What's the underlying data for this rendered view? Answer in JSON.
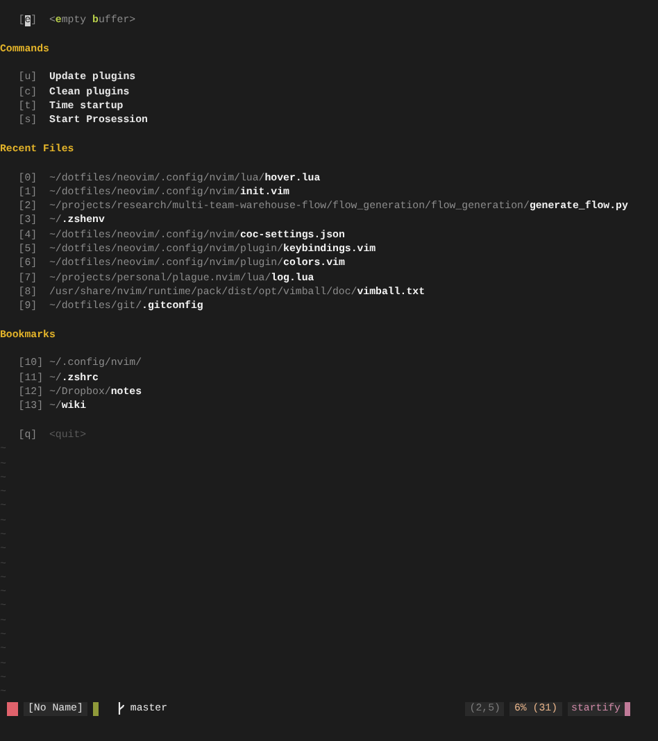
{
  "header": {
    "key_parts": [
      {
        "text": "[",
        "cursor": false
      },
      {
        "text": "e",
        "cursor": true
      },
      {
        "text": "]",
        "cursor": false
      }
    ],
    "label_parts": [
      {
        "text": "<",
        "hint": false
      },
      {
        "text": "e",
        "hint": true
      },
      {
        "text": "mpty ",
        "hint": false
      },
      {
        "text": "b",
        "hint": true
      },
      {
        "text": "uffer>",
        "hint": false
      }
    ]
  },
  "sections": [
    {
      "title": "Commands",
      "items": [
        {
          "kind": "command",
          "key": "[u]",
          "label": "Update plugins"
        },
        {
          "kind": "command",
          "key": "[c]",
          "label": "Clean plugins"
        },
        {
          "kind": "command",
          "key": "[t]",
          "label": "Time startup"
        },
        {
          "kind": "command",
          "key": "[s]",
          "label": "Start Prosession"
        }
      ]
    },
    {
      "title": "Recent Files",
      "items": [
        {
          "kind": "path",
          "key": "[0]",
          "dir": "~/dotfiles/neovim/.config/nvim/lua/",
          "file": "hover.lua"
        },
        {
          "kind": "path",
          "key": "[1]",
          "dir": "~/dotfiles/neovim/.config/nvim/",
          "file": "init.vim"
        },
        {
          "kind": "path",
          "key": "[2]",
          "dir": "~/projects/research/multi-team-warehouse-flow/flow_generation/flow_generation/",
          "file": "generate_flow.py"
        },
        {
          "kind": "path",
          "key": "[3]",
          "dir": "~/",
          "file": ".zshenv"
        },
        {
          "kind": "path",
          "key": "[4]",
          "dir": "~/dotfiles/neovim/.config/nvim/",
          "file": "coc-settings.json"
        },
        {
          "kind": "path",
          "key": "[5]",
          "dir": "~/dotfiles/neovim/.config/nvim/plugin/",
          "file": "keybindings.vim"
        },
        {
          "kind": "path",
          "key": "[6]",
          "dir": "~/dotfiles/neovim/.config/nvim/plugin/",
          "file": "colors.vim"
        },
        {
          "kind": "path",
          "key": "[7]",
          "dir": "~/projects/personal/plague.nvim/lua/",
          "file": "log.lua"
        },
        {
          "kind": "path",
          "key": "[8]",
          "dir": "/usr/share/nvim/runtime/pack/dist/opt/vimball/doc/",
          "file": "vimball.txt"
        },
        {
          "kind": "path",
          "key": "[9]",
          "dir": "~/dotfiles/git/",
          "file": ".gitconfig"
        }
      ]
    },
    {
      "title": "Bookmarks",
      "items": [
        {
          "kind": "path",
          "key": "[10]",
          "dir": "~/.config/nvim/"
        },
        {
          "kind": "path",
          "key": "[11]",
          "dir": "~/",
          "file": ".zshrc"
        },
        {
          "kind": "path",
          "key": "[12]",
          "dir": "~/Dropbox/",
          "file": "notes"
        },
        {
          "kind": "path",
          "key": "[13]",
          "dir": "~/",
          "file": "wiki"
        }
      ]
    }
  ],
  "quit": {
    "key": "[q]",
    "label": "<quit>"
  },
  "empty_lines": [
    "~",
    "~",
    "~",
    "~",
    "~",
    "~",
    "~",
    "~",
    "~",
    "~",
    "~",
    "~",
    "~",
    "~",
    "~",
    "~",
    "~",
    "~"
  ],
  "status_bar": {
    "buffer_name": "[No Name]",
    "branch": "master",
    "position": "(2,5)",
    "percent": "6% (31)",
    "filetype": "startify"
  }
}
